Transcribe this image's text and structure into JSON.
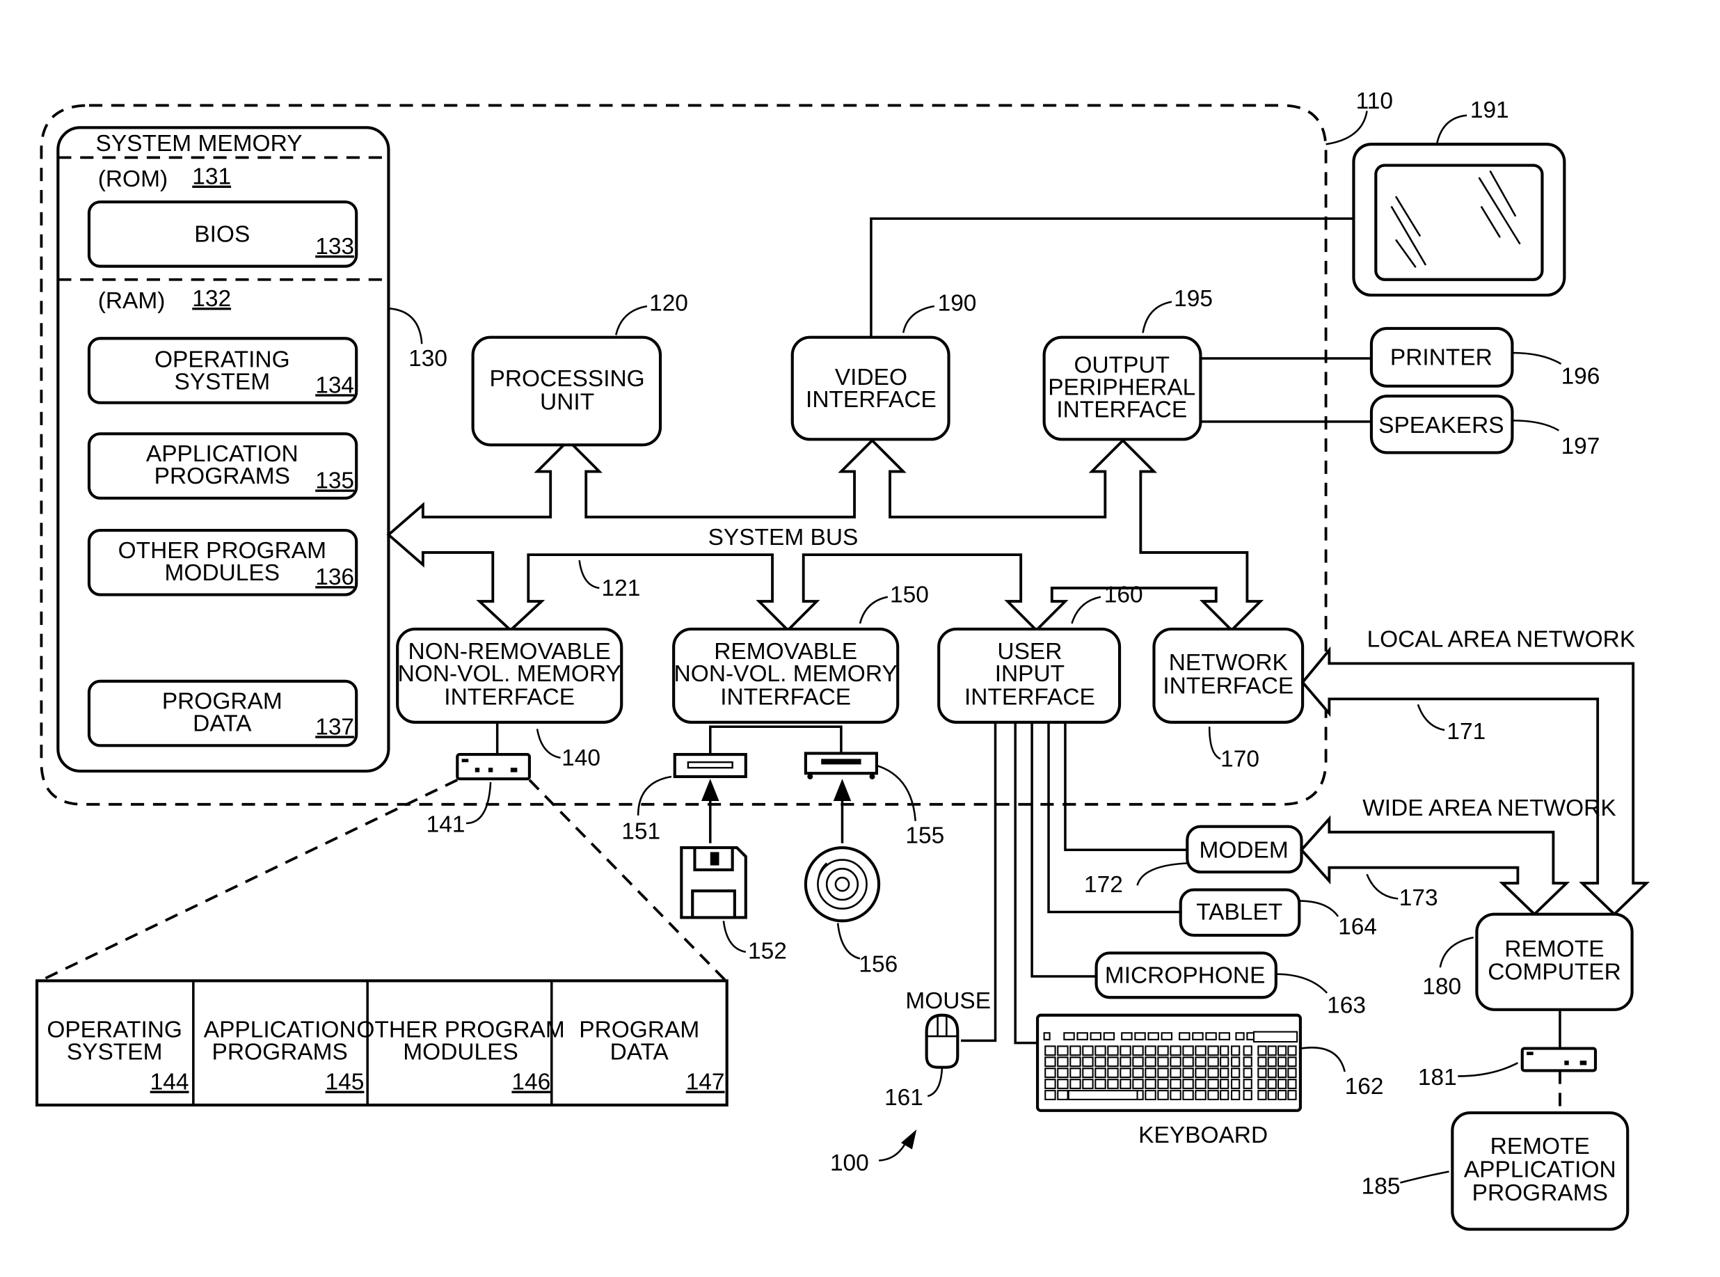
{
  "figure_number": "100",
  "computer": {
    "ref": "110"
  },
  "system_memory": {
    "title": "SYSTEM MEMORY",
    "ref": "130",
    "rom": {
      "label": "(ROM)",
      "ref": "131"
    },
    "ram": {
      "label": "(RAM)",
      "ref": "132"
    },
    "bios": {
      "lines": [
        "BIOS"
      ],
      "ref": "133"
    },
    "operating_system": {
      "lines": [
        "OPERATING",
        "SYSTEM"
      ],
      "ref": "134"
    },
    "application_programs": {
      "lines": [
        "APPLICATION",
        "PROGRAMS"
      ],
      "ref": "135"
    },
    "other_program_modules": {
      "lines": [
        "OTHER PROGRAM",
        "MODULES"
      ],
      "ref": "136"
    },
    "program_data": {
      "lines": [
        "PROGRAM",
        "DATA"
      ],
      "ref": "137"
    }
  },
  "processing_unit": {
    "lines": [
      "PROCESSING",
      "UNIT"
    ],
    "ref": "120"
  },
  "video_interface": {
    "lines": [
      "VIDEO",
      "INTERFACE"
    ],
    "ref": "190"
  },
  "output_peripheral_interface": {
    "lines": [
      "OUTPUT",
      "PERIPHERAL",
      "INTERFACE"
    ],
    "ref": "195"
  },
  "monitor": {
    "ref": "191"
  },
  "printer": {
    "label": "PRINTER",
    "ref": "196"
  },
  "speakers": {
    "label": "SPEAKERS",
    "ref": "197"
  },
  "system_bus": {
    "label": "SYSTEM BUS",
    "ref": "121"
  },
  "non_removable_interface": {
    "lines": [
      "NON-REMOVABLE",
      "NON-VOL. MEMORY",
      "INTERFACE"
    ],
    "ref": "140"
  },
  "removable_interface": {
    "lines": [
      "REMOVABLE",
      "NON-VOL. MEMORY",
      "INTERFACE"
    ],
    "ref": "150"
  },
  "user_input_interface": {
    "lines": [
      "USER",
      "INPUT",
      "INTERFACE"
    ],
    "ref": "160"
  },
  "network_interface": {
    "lines": [
      "NETWORK",
      "INTERFACE"
    ],
    "ref": "170"
  },
  "hard_disk": {
    "ref": "141"
  },
  "floppy_drive": {
    "ref": "151"
  },
  "optical_drive": {
    "ref": "155"
  },
  "floppy_disk": {
    "ref": "152"
  },
  "optical_disk": {
    "ref": "156"
  },
  "lan": {
    "label": "LOCAL AREA NETWORK",
    "ref": "171"
  },
  "wan": {
    "label": "WIDE AREA NETWORK",
    "ref": "173"
  },
  "modem": {
    "label": "MODEM",
    "ref": "172"
  },
  "tablet": {
    "label": "TABLET",
    "ref": "164"
  },
  "microphone": {
    "label": "MICROPHONE",
    "ref": "163"
  },
  "mouse": {
    "label": "MOUSE",
    "ref": "161"
  },
  "keyboard": {
    "label": "KEYBOARD",
    "ref": "162"
  },
  "remote_computer": {
    "lines": [
      "REMOTE",
      "COMPUTER"
    ],
    "ref": "180"
  },
  "remote_hard_disk": {
    "ref": "181"
  },
  "remote_application_programs": {
    "lines": [
      "REMOTE",
      "APPLICATION",
      "PROGRAMS"
    ],
    "ref": "185"
  },
  "disk_contents": [
    {
      "lines": [
        "OPERATING",
        "SYSTEM"
      ],
      "ref": "144"
    },
    {
      "lines": [
        "APPLICATION",
        "PROGRAMS"
      ],
      "ref": "145"
    },
    {
      "lines": [
        "OTHER PROGRAM",
        "MODULES"
      ],
      "ref": "146"
    },
    {
      "lines": [
        "PROGRAM",
        "DATA"
      ],
      "ref": "147"
    }
  ]
}
